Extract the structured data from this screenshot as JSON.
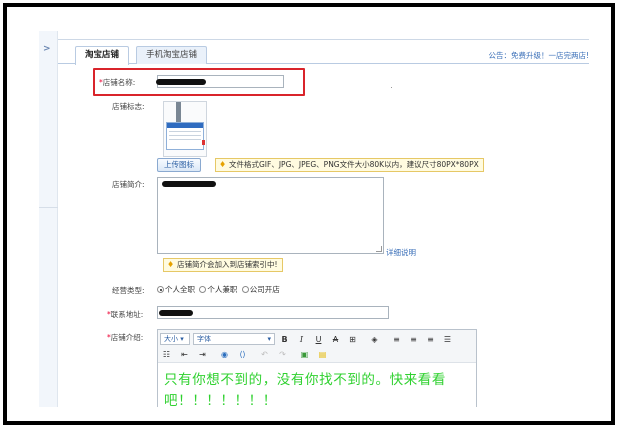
{
  "tabs": [
    {
      "label": "淘宝店铺",
      "active": true
    },
    {
      "label": "手机淘宝店铺",
      "active": false
    }
  ],
  "notice_text": "公告：免费升级！一店完两店!",
  "collapse_arrow": ">",
  "form": {
    "shop_name_label": "店铺名称:",
    "shop_logo_label": "店铺标志:",
    "upload_button": "上传图标",
    "upload_tip": "文件格式GIF、JPG、JPEG、PNG文件大小80K以内，建议尺寸80PX*80PX",
    "shop_intro_label": "店铺简介:",
    "detail_link": "详细说明",
    "intro_tip": "店铺简介会加入到店铺索引中!",
    "business_type_label": "经营类型:",
    "business_options": [
      {
        "label": "个人全职",
        "checked": true
      },
      {
        "label": "个人兼职",
        "checked": false
      },
      {
        "label": "公司开店",
        "checked": false
      }
    ],
    "contact_label": "联系地址:",
    "shop_desc_label": "店铺介绍:",
    "required_mark": "*"
  },
  "editor": {
    "size_select": "大小",
    "font_select": "字体",
    "content": "只有你想不到的，没有你找不到的。快来看看吧！！！！！！！"
  },
  "colors": {
    "highlight_border": "#d9242b",
    "editor_text": "#2fd12f",
    "link": "#3a6fb8"
  }
}
